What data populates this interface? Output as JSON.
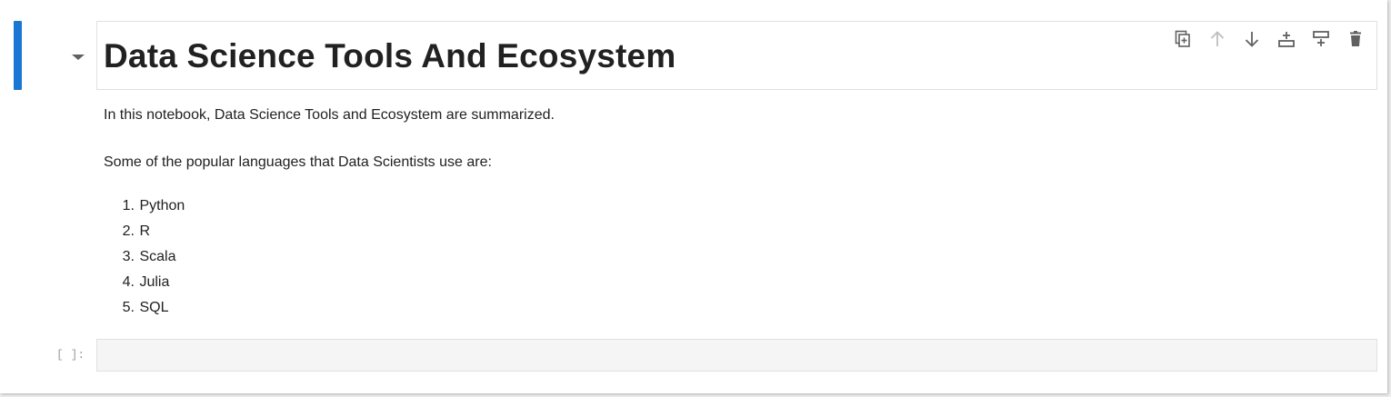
{
  "heading_cell": {
    "title": "Data Science Tools And Ecosystem",
    "toolbar": [
      {
        "name": "duplicate-cell-button",
        "icon": "copy-icon",
        "enabled": true
      },
      {
        "name": "move-up-button",
        "icon": "arrow-up-icon",
        "enabled": false
      },
      {
        "name": "move-down-button",
        "icon": "arrow-down-icon",
        "enabled": true
      },
      {
        "name": "insert-above-button",
        "icon": "insert-above-icon",
        "enabled": true
      },
      {
        "name": "insert-below-button",
        "icon": "insert-below-icon",
        "enabled": true
      },
      {
        "name": "delete-cell-button",
        "icon": "trash-icon",
        "enabled": true
      }
    ]
  },
  "markdown": {
    "intro": "In this notebook, Data Science Tools and Ecosystem are summarized.",
    "languages_intro": "Some of the popular languages that Data Scientists use are:",
    "languages": [
      {
        "num": "1.",
        "label": "Python"
      },
      {
        "num": "2.",
        "label": "R"
      },
      {
        "num": "3.",
        "label": "Scala"
      },
      {
        "num": "4.",
        "label": "Julia"
      },
      {
        "num": "5.",
        "label": "SQL"
      }
    ]
  },
  "code_cell": {
    "prompt": "[ ]:",
    "content": ""
  },
  "colors": {
    "active_bar": "#1976d2",
    "icon_enabled": "#616161",
    "icon_disabled": "#bdbdbd",
    "code_background": "#f5f5f5"
  }
}
